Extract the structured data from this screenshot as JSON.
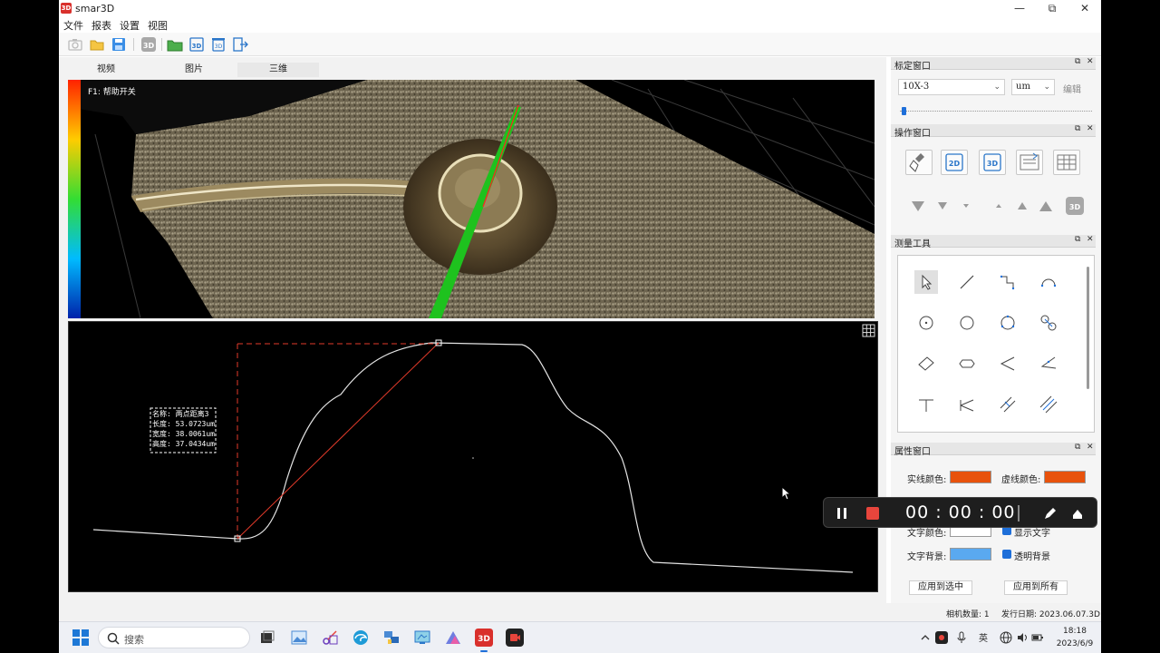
{
  "app": {
    "title": "smar3D",
    "icon_text": "3D"
  },
  "window_controls": {
    "minimize": "—",
    "maximize": "⧉",
    "close": "✕"
  },
  "menu": [
    "文件",
    "报表",
    "设置",
    "视图"
  ],
  "tabs": [
    {
      "label": "视频",
      "active": false
    },
    {
      "label": "图片",
      "active": false
    },
    {
      "label": "三维",
      "active": true
    }
  ],
  "view3d": {
    "help_hint": "F1: 帮助开关"
  },
  "measurement": {
    "name_label": "名称: 两点距离3",
    "length_label": "长度: 53.0723um",
    "width_label": "宽度: 38.0061um",
    "height_label": "高度: 37.0434um"
  },
  "calibration_panel": {
    "title": "标定窗口",
    "lens": "10X-3",
    "unit": "um",
    "edit_label": "编辑"
  },
  "operation_panel": {
    "title": "操作窗口"
  },
  "measure_tools_panel": {
    "title": "测量工具"
  },
  "property_panel": {
    "title": "属性窗口",
    "solid_color_label": "实线颜色:",
    "dashed_color_label": "虚线颜色:",
    "text_color_label": "文字颜色:",
    "show_text_label": "显示文字",
    "text_bg_label": "文字背景:",
    "transparent_bg_label": "透明背景",
    "apply_selected": "应用到选中",
    "apply_all": "应用到所有",
    "colors": {
      "solid": "#e8520c",
      "dashed": "#e8520c",
      "text": "#ffffff",
      "text_bg": "#5aa9f0"
    }
  },
  "status": {
    "camera_count": "相机数量: 1",
    "release_date": "发行日期: 2023.06.07.3D"
  },
  "recorder": {
    "time": "00 : 00 : 00"
  },
  "taskbar": {
    "search_placeholder": "搜索",
    "time": "18:18",
    "date": "2023/6/9"
  }
}
